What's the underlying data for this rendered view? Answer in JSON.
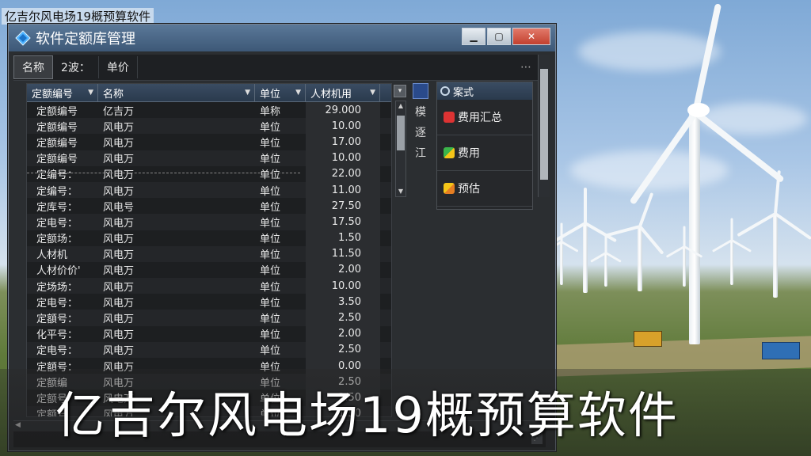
{
  "page_caption": "亿吉尔风电场19概预算软件",
  "window": {
    "title": "软件定额库管理",
    "controls": {
      "minimize": "▁",
      "maximize": "▢",
      "close": "✕"
    }
  },
  "tabs": [
    "名称",
    "2波：",
    "单价"
  ],
  "tab_more": "⋯",
  "grid": {
    "columns": [
      "定额编号",
      "名称",
      "单位",
      "人材机用"
    ],
    "rows": [
      [
        "定额编号",
        "亿吉万",
        "单称",
        "29.000"
      ],
      [
        "定额编号",
        "风电万",
        "单位",
        "10.00"
      ],
      [
        "定额编号",
        "风电万",
        "单位",
        "17.00"
      ],
      [
        "定额编号",
        "风电万",
        "单位",
        "10.00"
      ],
      [
        "定编号：",
        "风电万",
        "单位",
        "22.00"
      ],
      [
        "定编号：",
        "风电万",
        "单位",
        "11.00"
      ],
      [
        "定库号：",
        "风电号",
        "单位",
        "27.50"
      ],
      [
        "定电号：",
        "风电万",
        "单位",
        "17.50"
      ],
      [
        "定额场：",
        "风电万",
        "单位",
        "1.50"
      ],
      [
        "人材机",
        "风电万",
        "单位",
        "11.50"
      ],
      [
        "人材价价'",
        "风电万",
        "单位",
        "2.00"
      ],
      [
        "定场场：",
        "风电万",
        "单位",
        "10.00"
      ],
      [
        "定电号：",
        "风电万",
        "单位",
        "3.50"
      ],
      [
        "定額号：",
        "风电万",
        "单位",
        "2.50"
      ],
      [
        "化平号：",
        "风电万",
        "单位",
        "2.00"
      ],
      [
        "定电号：",
        "风电万",
        "单位",
        "2.50"
      ],
      [
        "定額号：",
        "风电万",
        "单位",
        "0.00"
      ],
      [
        "定额编",
        "风电万",
        "单位",
        "2.50"
      ],
      [
        "定额号",
        "风电万",
        "单位",
        "2.50"
      ],
      [
        "定额号",
        "风电万",
        "单位",
        "1.50"
      ]
    ]
  },
  "side_tools": [
    "模",
    "逐",
    "江"
  ],
  "right_panel": {
    "header": "案式",
    "items": [
      "费用汇总",
      "费用",
      "预估"
    ]
  },
  "banner": "亿吉尔风电场19概预算软件"
}
